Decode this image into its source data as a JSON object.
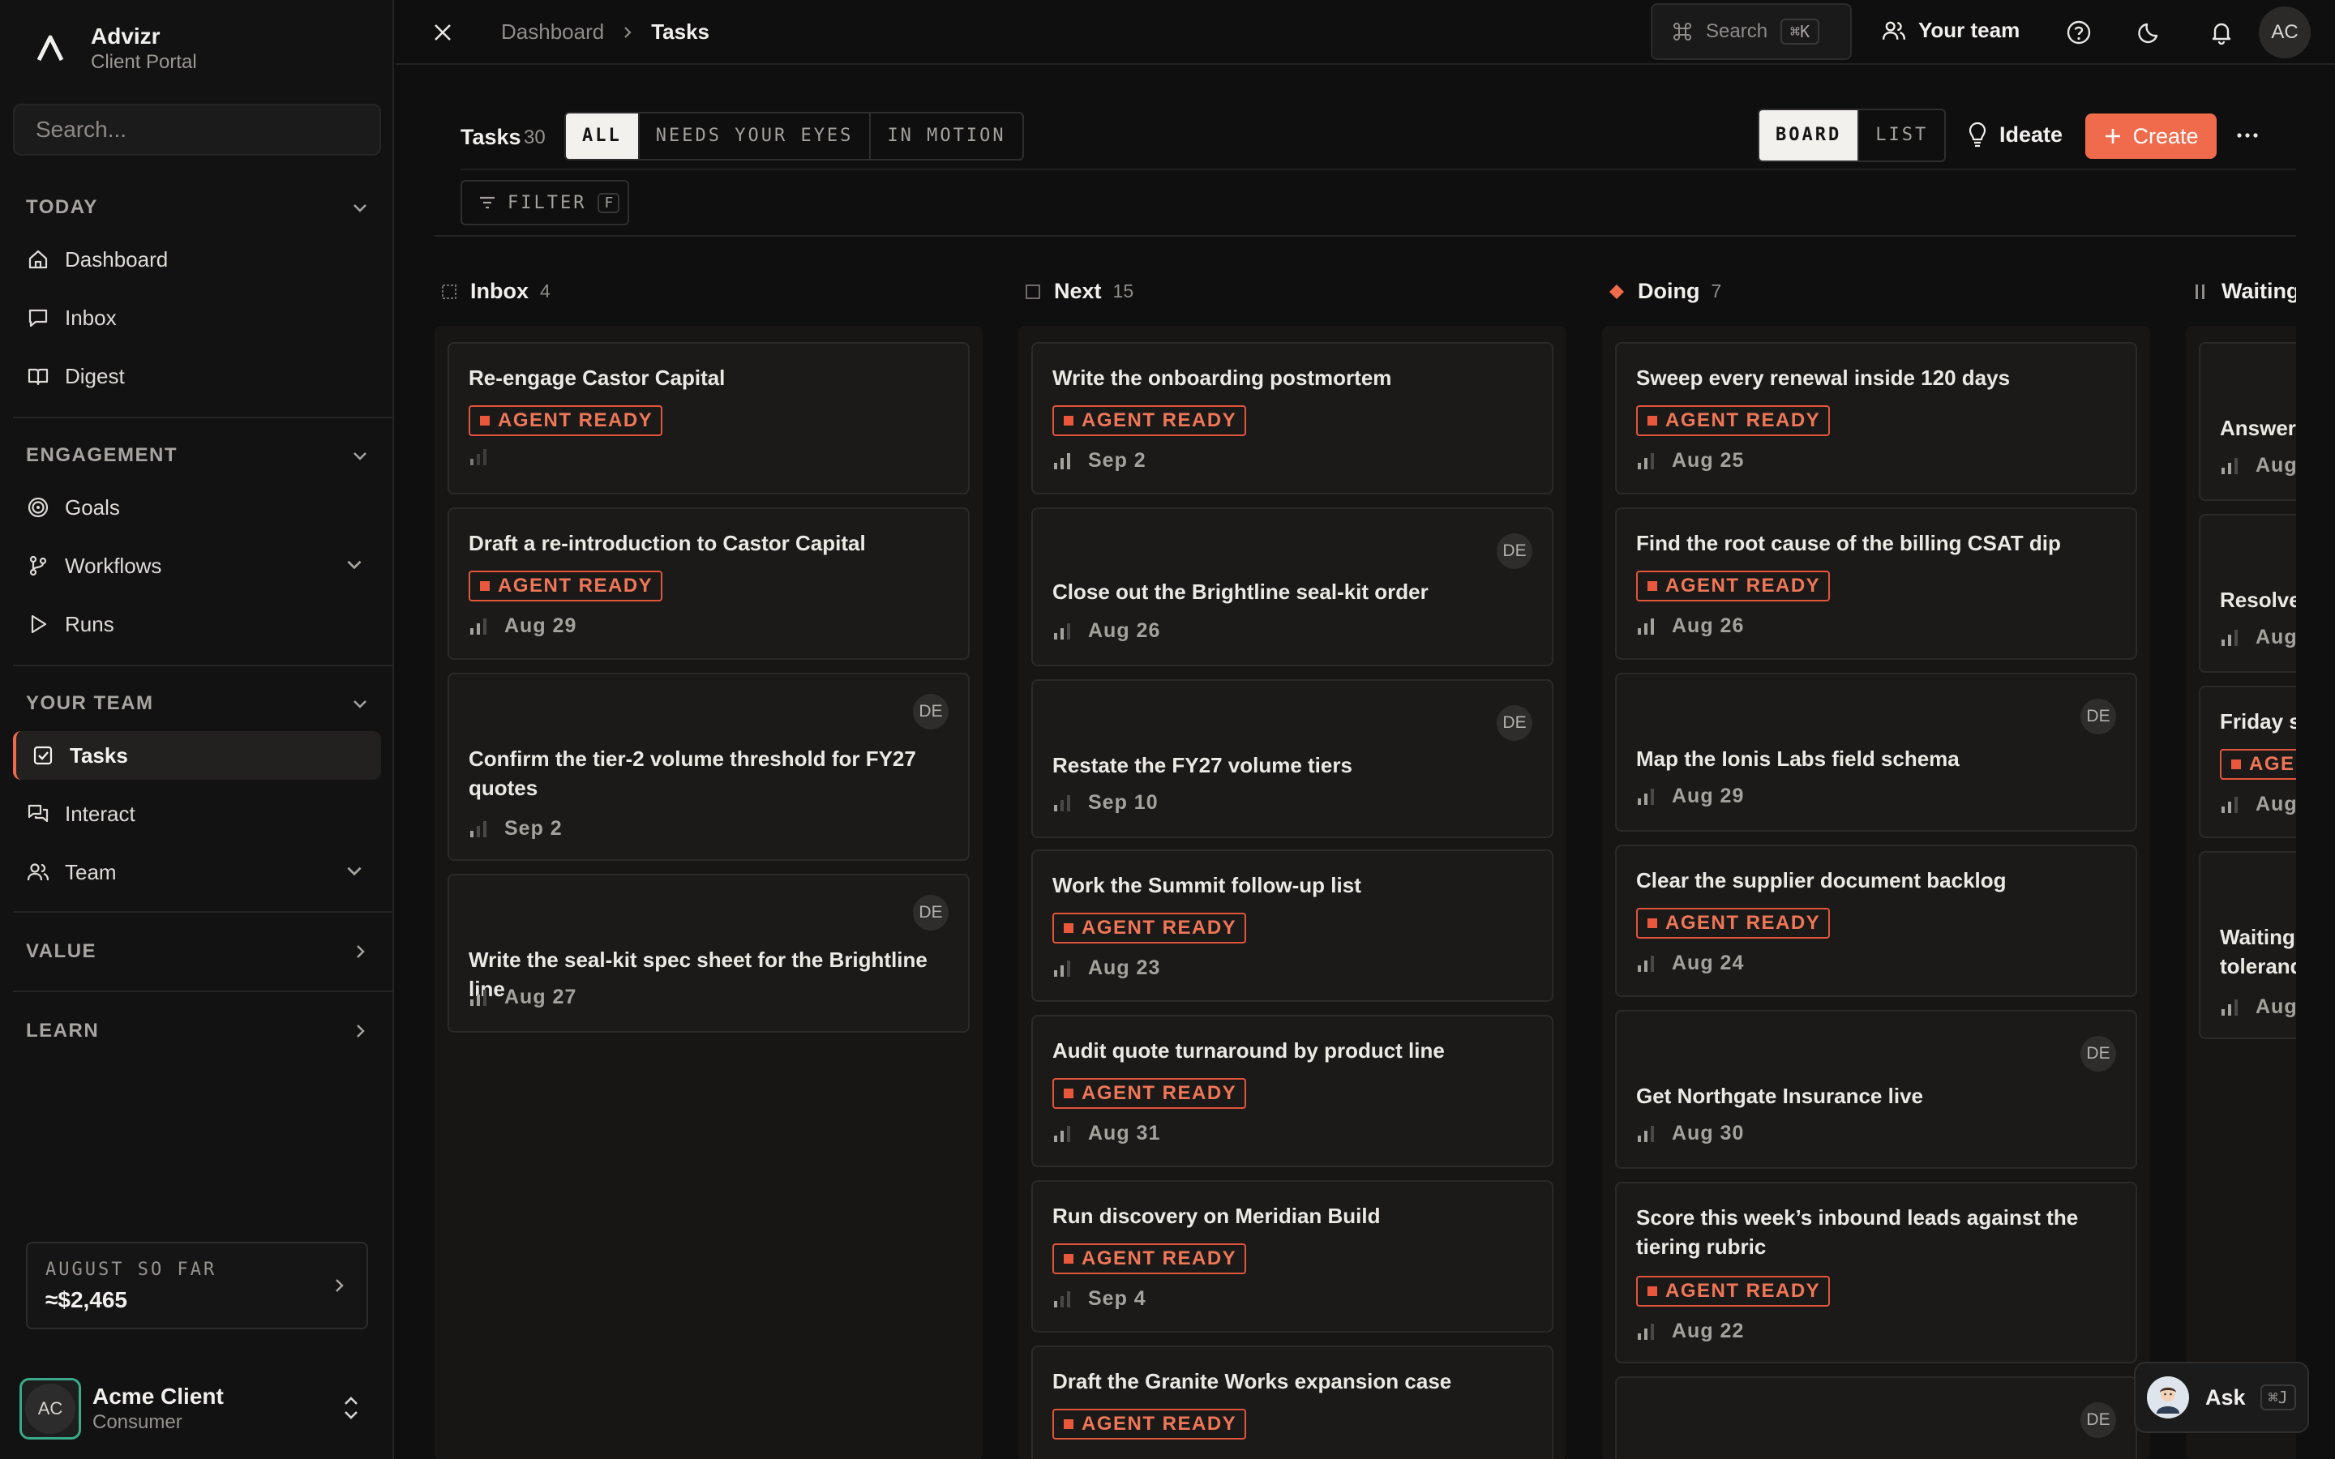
{
  "brand": {
    "name": "Advizr",
    "subtitle": "Client Portal"
  },
  "sidebar": {
    "search_placeholder": "Search...",
    "today_label": "TODAY",
    "today_items": [
      "Dashboard",
      "Inbox",
      "Digest"
    ],
    "engagement_label": "ENGAGEMENT",
    "engagement_items": [
      "Goals",
      "Workflows",
      "Runs"
    ],
    "team_label": "YOUR TEAM",
    "team_items": [
      "Tasks",
      "Interact",
      "Team"
    ],
    "value_label": "VALUE",
    "learn_label": "LEARN",
    "summary": {
      "label": "AUGUST SO FAR",
      "value": "≈$2,465"
    },
    "user": {
      "initials": "AC",
      "name": "Acme Client",
      "role": "Consumer"
    }
  },
  "topbar": {
    "breadcrumb": [
      "Dashboard",
      "Tasks"
    ],
    "search_label": "Search",
    "search_shortcut": "⌘K",
    "team_label": "Your team",
    "avatar_initials": "AC"
  },
  "tasks_header": {
    "title": "Tasks",
    "count": "30",
    "filters": [
      "ALL",
      "NEEDS YOUR EYES",
      "IN MOTION"
    ],
    "active_filter": "ALL",
    "views": [
      "BOARD",
      "LIST"
    ],
    "active_view": "BOARD",
    "ideate_label": "Ideate",
    "create_label": "Create",
    "filter_label": "FILTER",
    "filter_key": "F"
  },
  "tag_label": "AGENT READY",
  "assignee_initials": "DE",
  "columns": [
    {
      "name": "Inbox",
      "count": "4",
      "cards": [
        {
          "title": "Re-engage Castor Capital",
          "tag": true,
          "date": ""
        },
        {
          "title": "Draft a re-introduction to Castor Capital",
          "tag": true,
          "date": "Aug 29"
        },
        {
          "title": "Confirm the tier-2 volume threshold for FY27 quotes",
          "tag": false,
          "assignee": true,
          "date": "Sep 2"
        },
        {
          "title": "Write the seal-kit spec sheet for the Brightline line",
          "tag": false,
          "assignee": true,
          "date": "Aug 27"
        }
      ]
    },
    {
      "name": "Next",
      "count": "15",
      "cards": [
        {
          "title": "Write the onboarding postmortem",
          "tag": true,
          "date": "Sep 2"
        },
        {
          "title": "Close out the Brightline seal-kit order",
          "tag": false,
          "assignee": true,
          "date": "Aug 26"
        },
        {
          "title": "Restate the FY27 volume tiers",
          "tag": false,
          "assignee": true,
          "date": "Sep 10"
        },
        {
          "title": "Work the Summit follow-up list",
          "tag": true,
          "date": "Aug 23"
        },
        {
          "title": "Audit quote turnaround by product line",
          "tag": true,
          "date": "Aug 31"
        },
        {
          "title": "Run discovery on Meridian Build",
          "tag": true,
          "date": "Sep 4"
        },
        {
          "title": "Draft the Granite Works expansion case",
          "tag": true,
          "date": ""
        }
      ]
    },
    {
      "name": "Doing",
      "count": "7",
      "cards": [
        {
          "title": "Sweep every renewal inside 120 days",
          "tag": true,
          "date": "Aug 25"
        },
        {
          "title": "Find the root cause of the billing CSAT dip",
          "tag": true,
          "date": "Aug 26"
        },
        {
          "title": "Map the Ionis Labs field schema",
          "tag": false,
          "assignee": true,
          "date": "Aug 29"
        },
        {
          "title": "Clear the supplier document backlog",
          "tag": true,
          "date": "Aug 24"
        },
        {
          "title": "Get Northgate Insurance live",
          "tag": false,
          "assignee": true,
          "date": "Aug 30"
        },
        {
          "title": "Score this week’s inbound leads against the tiering rubric",
          "tag": true,
          "date": "Aug 22"
        },
        {
          "title": "",
          "tag": false,
          "assignee": true,
          "date": ""
        }
      ]
    },
    {
      "name": "Waiting",
      "count": "",
      "cards": [
        {
          "title": "Answer",
          "tag": false,
          "date": "Aug"
        },
        {
          "title": "Resolve",
          "tag": false,
          "date": "Aug"
        },
        {
          "title": "Friday s",
          "tag": true,
          "date": "Aug"
        },
        {
          "title": "Waiting tolerand",
          "tag": false,
          "date": "Aug"
        }
      ]
    }
  ],
  "ask": {
    "label": "Ask",
    "shortcut": "⌘J"
  },
  "colors": {
    "accent": "#ef6b4b",
    "background": "#0f0f0f",
    "sidebar": "#121212"
  }
}
